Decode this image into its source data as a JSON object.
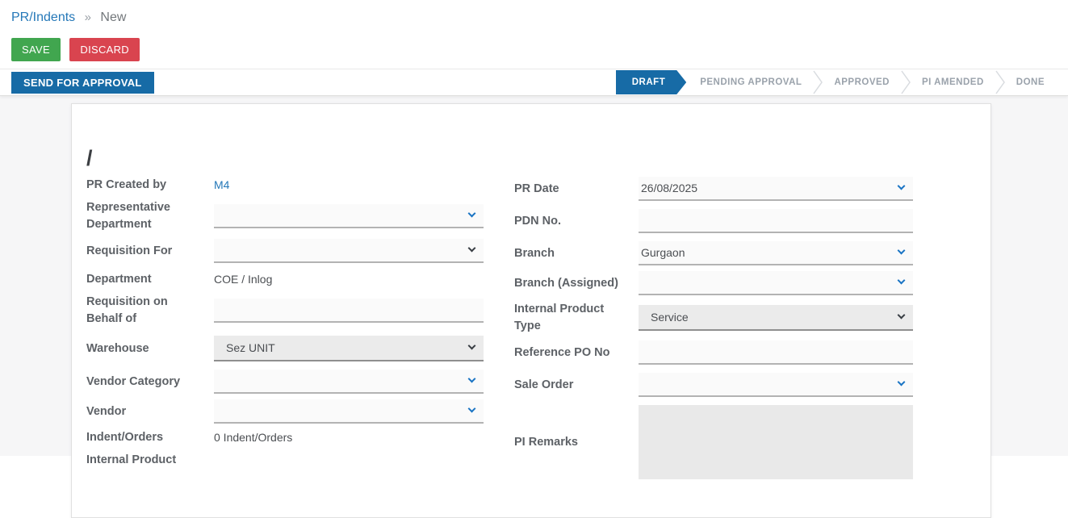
{
  "breadcrumb": {
    "root": "PR/Indents",
    "separator": "»",
    "current": "New"
  },
  "toolbar": {
    "save": "SAVE",
    "discard": "DISCARD"
  },
  "action_bar": {
    "send_for_approval": "SEND FOR APPROVAL"
  },
  "statusbar": {
    "active_step": "DRAFT",
    "steps": [
      "DRAFT",
      "PENDING APPROVAL",
      "APPROVED",
      "PI AMENDED",
      "DONE"
    ]
  },
  "sheet": {
    "title": "/",
    "left": [
      {
        "label": "PR Created by",
        "value": "M4"
      },
      {
        "label": "Representative Department",
        "value": ""
      },
      {
        "label": "Requisition For",
        "value": ""
      },
      {
        "label": "Department",
        "value": "COE / Inlog"
      },
      {
        "label": "Requisition on Behalf of",
        "value": ""
      },
      {
        "label": "Warehouse",
        "value": "Sez UNIT"
      },
      {
        "label": "Vendor Category",
        "value": ""
      },
      {
        "label": "Vendor",
        "value": ""
      },
      {
        "label": "Indent/Orders",
        "value": "0 Indent/Orders"
      },
      {
        "label": "Internal Product",
        "value": ""
      }
    ],
    "right": [
      {
        "label": "PR Date",
        "value": "26/08/2025"
      },
      {
        "label": "PDN No.",
        "value": ""
      },
      {
        "label": "Branch",
        "value": "Gurgaon"
      },
      {
        "label": "Branch (Assigned)",
        "value": ""
      },
      {
        "label": "Internal Product Type",
        "value": "Service"
      },
      {
        "label": "Reference PO No",
        "value": ""
      },
      {
        "label": "Sale Order",
        "value": ""
      },
      {
        "label": "PI Remarks",
        "value": ""
      }
    ]
  },
  "colors": {
    "primary_blue": "#176ba6",
    "link_blue": "#2578b8",
    "save_green": "#41a64f",
    "discard_red": "#d9444f",
    "status_gray": "#9aa2ab"
  }
}
